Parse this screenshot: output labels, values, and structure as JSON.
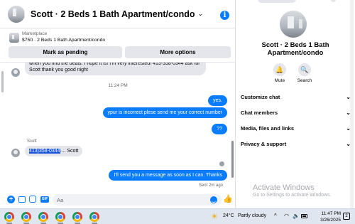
{
  "chat": {
    "header": {
      "title": "Scott · 2 Beds 1 Bath Apartment/condo",
      "chevron": "⌄",
      "info": "i"
    },
    "listing": {
      "marketplace_label": "Marketplace",
      "title": "$750 · 2 Beds 1 Bath Apartment/condo",
      "mark_pending": "Mark as pending",
      "more_options": "More options"
    },
    "messages": {
      "first_incoming": "when you find the deals. I hope it is! I'm very interested! 413-358-0344 ask for Scott thank you good night",
      "timestamp": "11:24 PM",
      "out_1": "yes.",
      "out_2": "ypur is incorrect plese send me your correct number",
      "out_3": "??",
      "sender": "Scott",
      "in_phone": "413)358-0344",
      "in_rest": ".... Scott",
      "out_4": "I'll send you a message as soon as I can. Thanks",
      "sent_status": "Sent 2m ago"
    },
    "composer": {
      "placeholder": "Aa",
      "plus": "+",
      "gif": "GIF",
      "like": "👍"
    }
  },
  "details": {
    "name": "Scott · 2 Beds 1 Bath Apartment/condo",
    "mute_label": "Mute",
    "search_label": "Search",
    "mute_icon": "🔔",
    "search_icon": "🔍",
    "sections": [
      {
        "label": "Customize chat"
      },
      {
        "label": "Chat members"
      },
      {
        "label": "Media, files and links"
      },
      {
        "label": "Privacy & support"
      }
    ],
    "chevron": "⌄",
    "activate_title": "Activate Windows",
    "activate_sub": "Go to Settings to activate Windows."
  },
  "taskbar": {
    "weather_icon": "☀",
    "temperature": "24°C",
    "weather_desc": "Partly cloudy",
    "tray_chevron": "^",
    "wifi": "◠",
    "volume": "🔈",
    "time": "11:47 PM",
    "date": "3/26/2025",
    "notifications": "2"
  },
  "colors": {
    "accent": "#0a7cff",
    "bubble_in": "#e4e6eb",
    "highlight": "#1a56db"
  }
}
